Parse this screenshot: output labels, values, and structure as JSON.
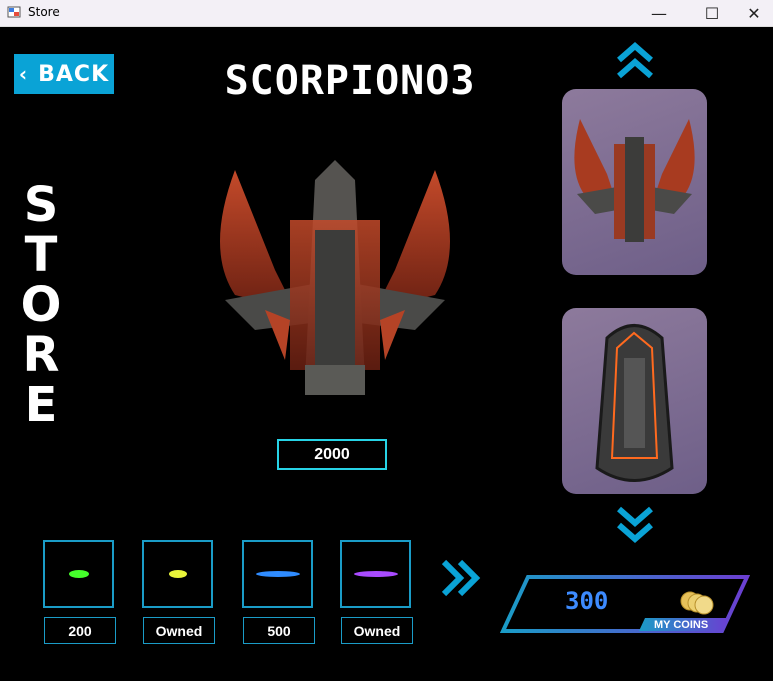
{
  "window": {
    "title": "Store",
    "minimize_glyph": "—",
    "maximize_glyph": "☐",
    "close_glyph": "✕"
  },
  "back_button": {
    "label": "BACK",
    "chevron": "‹"
  },
  "ship": {
    "name": "SCORPIONO3",
    "price": "2000"
  },
  "store_title": "STORE",
  "bullets": [
    {
      "price_label": "200",
      "color": "#45ff2b"
    },
    {
      "price_label": "Owned",
      "color": "#e9f53a"
    },
    {
      "price_label": "500",
      "color": "#2f8cff"
    },
    {
      "price_label": "Owned",
      "color": "#a94bff"
    }
  ],
  "coins": {
    "value": "300",
    "label": "MY COINS"
  },
  "colors": {
    "accent": "#0aa3d6",
    "price_border": "#27d3e6",
    "coins_blue": "#3d8bff",
    "card_bg": "#7e6d93"
  },
  "icons": [
    "app-icon",
    "chevron-up-double-icon",
    "chevron-down-double-icon",
    "chevron-right-double-icon",
    "coin-stack-icon"
  ]
}
